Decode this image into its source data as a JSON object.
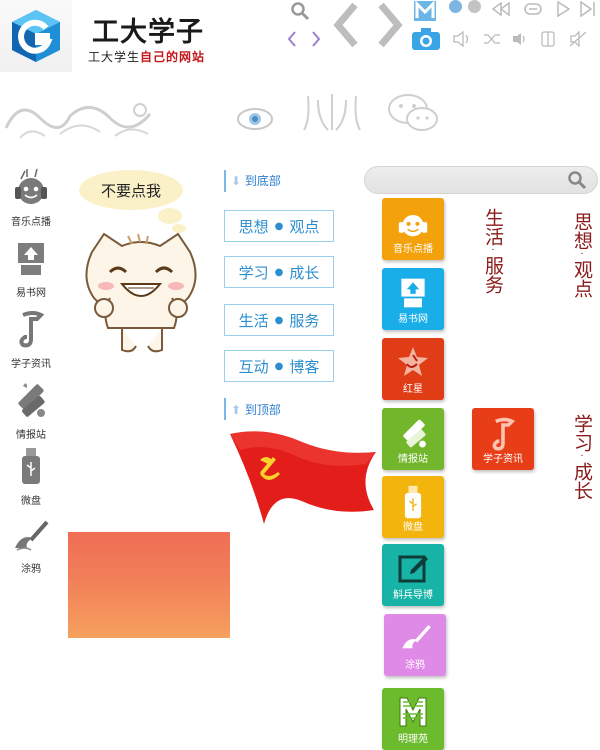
{
  "header": {
    "title": "工大学子",
    "subtitle_pre": "工大学生",
    "subtitle_hl": "自己的网站",
    "icons": [
      "search-icon",
      "code-icon",
      "back-icon",
      "forward-icon",
      "m-icon",
      "dot-icon",
      "dot-icon",
      "rewind-icon",
      "loop-icon",
      "play-icon",
      "skip-icon",
      "camera-icon",
      "volume-icon",
      "shuffle-icon",
      "speaker-icon",
      "pause-icon",
      "mute-icon"
    ]
  },
  "left_nav": [
    {
      "label": "音乐点播",
      "icon": "headphone-face-icon"
    },
    {
      "label": "易书网",
      "icon": "book-box-icon"
    },
    {
      "label": "学子资讯",
      "icon": "note-icon"
    },
    {
      "label": "情报站",
      "icon": "intel-icon"
    },
    {
      "label": "微盘",
      "icon": "usb-drive-icon"
    },
    {
      "label": "涂鸦",
      "icon": "paint-icon"
    }
  ],
  "bubble": "不要点我",
  "links": {
    "to_bottom": "到底部",
    "to_top": "到顶部"
  },
  "categories": [
    {
      "a": "思想",
      "b": "观点"
    },
    {
      "a": "学习",
      "b": "成长"
    },
    {
      "a": "生活",
      "b": "服务"
    },
    {
      "a": "互动",
      "b": "博客"
    }
  ],
  "search": {
    "placeholder": ""
  },
  "tiles": [
    {
      "label": "音乐点播",
      "color": "#f4a20c",
      "icon": "headphone-face-icon"
    },
    {
      "label": "易书网",
      "color": "#1aaee8",
      "icon": "book-box-icon"
    },
    {
      "label": "红星",
      "color": "#e03c16",
      "icon": "red-star-icon"
    },
    {
      "label": "情报站",
      "color": "#72b62c",
      "icon": "intel-icon"
    },
    {
      "label": "微盘",
      "color": "#f3b40e",
      "icon": "usb-drive-icon"
    },
    {
      "label": "斛兵导博",
      "color": "#17b3a6",
      "icon": "edit-icon"
    },
    {
      "label": "涂鸦",
      "color": "#e08ae8",
      "icon": "paint-icon"
    },
    {
      "label": "明理苑",
      "color": "#6cbb2c",
      "icon": "m-letter-icon"
    },
    {
      "label": "学子资讯",
      "color": "#e83e18",
      "icon": "note-icon"
    }
  ],
  "vertical_labels": [
    {
      "a": "生活",
      "b": "服务"
    },
    {
      "a": "思想",
      "b": "观点"
    },
    {
      "a": "学习",
      "b": "成长"
    }
  ]
}
